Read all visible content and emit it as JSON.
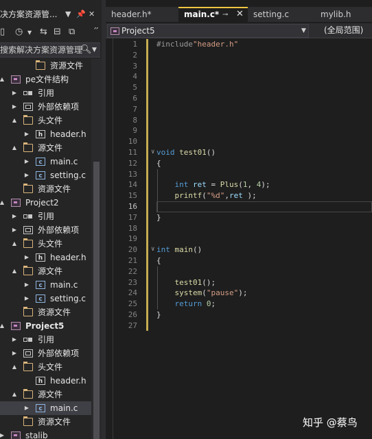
{
  "solution_explorer": {
    "title": "决方案资源管...",
    "search_placeholder": "搜索解决方案资源管理",
    "toolbar_icons": [
      "home-icon",
      "history-icon",
      "sync-icon",
      "collapse-icon",
      "copy-icon"
    ],
    "tree": [
      {
        "label": "资源文件",
        "icon": "folder-icon",
        "depth": 2,
        "expander": "",
        "selected": false,
        "bold": false
      },
      {
        "label": "pe文件结构",
        "icon": "project-icon",
        "depth": 0,
        "expander": "▲",
        "selected": false,
        "bold": false
      },
      {
        "label": "引用",
        "icon": "reference-icon",
        "depth": 1,
        "expander": "▶",
        "selected": false,
        "bold": false
      },
      {
        "label": "外部依赖项",
        "icon": "external-deps-icon",
        "depth": 1,
        "expander": "▶",
        "selected": false,
        "bold": false
      },
      {
        "label": "头文件",
        "icon": "folder-icon",
        "depth": 1,
        "expander": "▲",
        "selected": false,
        "bold": false
      },
      {
        "label": "header.h",
        "icon": "header-file-icon",
        "depth": 2,
        "expander": "▶",
        "selected": false,
        "bold": false
      },
      {
        "label": "源文件",
        "icon": "folder-icon",
        "depth": 1,
        "expander": "▲",
        "selected": false,
        "bold": false
      },
      {
        "label": "main.c",
        "icon": "c-file-icon",
        "depth": 2,
        "expander": "▶",
        "selected": false,
        "bold": false
      },
      {
        "label": "setting.c",
        "icon": "c-file-icon",
        "depth": 2,
        "expander": "▶",
        "selected": false,
        "bold": false
      },
      {
        "label": "资源文件",
        "icon": "folder-icon",
        "depth": 1,
        "expander": "",
        "selected": false,
        "bold": false
      },
      {
        "label": "Project2",
        "icon": "project-icon",
        "depth": 0,
        "expander": "▲",
        "selected": false,
        "bold": false
      },
      {
        "label": "引用",
        "icon": "reference-icon",
        "depth": 1,
        "expander": "▶",
        "selected": false,
        "bold": false
      },
      {
        "label": "外部依赖项",
        "icon": "external-deps-icon",
        "depth": 1,
        "expander": "▶",
        "selected": false,
        "bold": false
      },
      {
        "label": "头文件",
        "icon": "folder-icon",
        "depth": 1,
        "expander": "▲",
        "selected": false,
        "bold": false
      },
      {
        "label": "header.h",
        "icon": "header-file-icon",
        "depth": 2,
        "expander": "▶",
        "selected": false,
        "bold": false
      },
      {
        "label": "源文件",
        "icon": "folder-icon",
        "depth": 1,
        "expander": "▲",
        "selected": false,
        "bold": false
      },
      {
        "label": "main.c",
        "icon": "c-file-icon",
        "depth": 2,
        "expander": "▶",
        "selected": false,
        "bold": false
      },
      {
        "label": "setting.c",
        "icon": "c-file-icon",
        "depth": 2,
        "expander": "▶",
        "selected": false,
        "bold": false
      },
      {
        "label": "资源文件",
        "icon": "folder-icon",
        "depth": 1,
        "expander": "",
        "selected": false,
        "bold": false
      },
      {
        "label": "Project5",
        "icon": "project-icon",
        "depth": 0,
        "expander": "▲",
        "selected": false,
        "bold": true
      },
      {
        "label": "引用",
        "icon": "reference-icon",
        "depth": 1,
        "expander": "▶",
        "selected": false,
        "bold": false
      },
      {
        "label": "外部依赖项",
        "icon": "external-deps-icon",
        "depth": 1,
        "expander": "▶",
        "selected": false,
        "bold": false
      },
      {
        "label": "头文件",
        "icon": "folder-icon",
        "depth": 1,
        "expander": "▲",
        "selected": false,
        "bold": false
      },
      {
        "label": "header.h",
        "icon": "header-file-icon",
        "depth": 2,
        "expander": "",
        "selected": false,
        "bold": false
      },
      {
        "label": "源文件",
        "icon": "folder-icon",
        "depth": 1,
        "expander": "▲",
        "selected": false,
        "bold": false
      },
      {
        "label": "main.c",
        "icon": "c-file-icon",
        "depth": 2,
        "expander": "▶",
        "selected": true,
        "bold": false
      },
      {
        "label": "资源文件",
        "icon": "folder-icon",
        "depth": 1,
        "expander": "",
        "selected": false,
        "bold": false
      },
      {
        "label": "stalib",
        "icon": "project-icon",
        "depth": 0,
        "expander": "▶",
        "selected": false,
        "bold": false
      }
    ]
  },
  "editor": {
    "tabs": [
      {
        "label": "header.h*",
        "active": false
      },
      {
        "label": "main.c*",
        "active": true
      },
      {
        "label": "setting.c",
        "active": false
      },
      {
        "label": "mylib.h",
        "active": false
      }
    ],
    "nav_project": "Project5",
    "nav_scope": "(全局范围)",
    "current_line": 16,
    "lines": [
      [
        [
          "pp",
          "#include"
        ],
        [
          "str",
          "\"header.h\""
        ]
      ],
      [],
      [],
      [],
      [],
      [],
      [],
      [],
      [],
      [],
      [
        [
          "kw",
          "void"
        ],
        [
          "txt",
          " "
        ],
        [
          "fn",
          "test01"
        ],
        [
          "txt",
          "()"
        ]
      ],
      [
        [
          "txt",
          "{"
        ]
      ],
      [],
      [
        [
          "txt",
          "    "
        ],
        [
          "kw",
          "int"
        ],
        [
          "txt",
          " "
        ],
        [
          "var",
          "ret"
        ],
        [
          "txt",
          " = "
        ],
        [
          "fn",
          "Plus"
        ],
        [
          "txt",
          "("
        ],
        [
          "num",
          "1"
        ],
        [
          "txt",
          ", "
        ],
        [
          "num",
          "4"
        ],
        [
          "txt",
          ");"
        ]
      ],
      [
        [
          "txt",
          "    "
        ],
        [
          "fn",
          "printf"
        ],
        [
          "txt",
          "("
        ],
        [
          "str",
          "\"%d\""
        ],
        [
          "txt",
          ","
        ],
        [
          "var",
          "ret"
        ],
        [
          "txt",
          " );"
        ]
      ],
      [],
      [
        [
          "txt",
          "}"
        ]
      ],
      [],
      [],
      [
        [
          "kw",
          "int"
        ],
        [
          "txt",
          " "
        ],
        [
          "fn",
          "main"
        ],
        [
          "txt",
          "()"
        ]
      ],
      [
        [
          "txt",
          "{"
        ]
      ],
      [],
      [
        [
          "txt",
          "    "
        ],
        [
          "fn",
          "test01"
        ],
        [
          "txt",
          "();"
        ]
      ],
      [
        [
          "txt",
          "    "
        ],
        [
          "fn",
          "system"
        ],
        [
          "txt",
          "("
        ],
        [
          "str",
          "\"pause\""
        ],
        [
          "txt",
          ");"
        ]
      ],
      [
        [
          "txt",
          "    "
        ],
        [
          "kw",
          "return"
        ],
        [
          "txt",
          " "
        ],
        [
          "num",
          "0"
        ],
        [
          "txt",
          ";"
        ]
      ],
      [
        [
          "txt",
          "}"
        ]
      ],
      []
    ]
  },
  "watermark": "知乎 @蔡鸟",
  "colors": {
    "keyword": "#569cd6",
    "string": "#d69d85",
    "function": "#dcdcaa",
    "variable": "#9cdcfe",
    "number": "#b5cea8",
    "active_tab_accent": "#f0c640",
    "modified_bar": "#e3c55c"
  }
}
